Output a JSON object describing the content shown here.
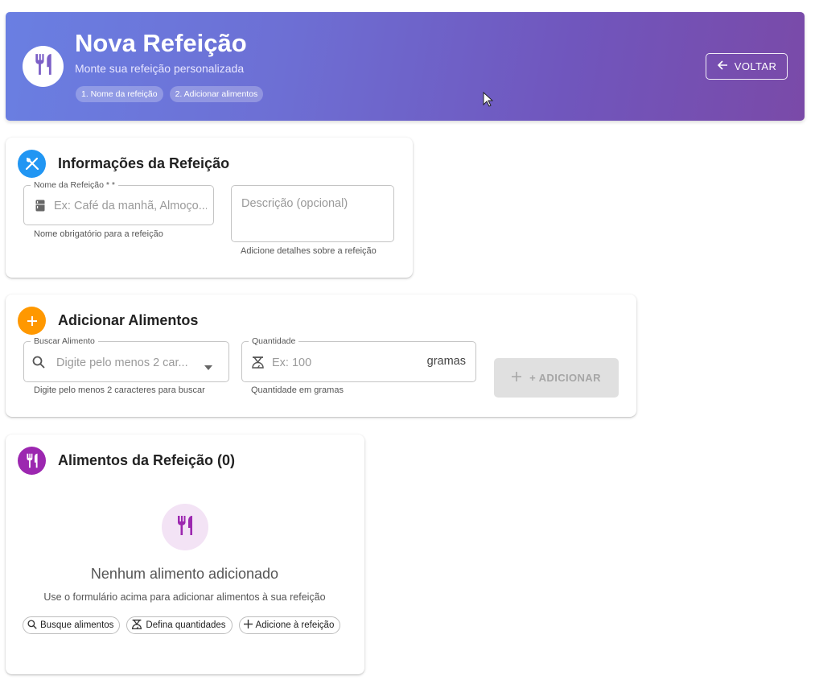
{
  "header": {
    "title": "Nova Refeição",
    "subtitle": "Monte sua refeição personalizada",
    "steps": [
      "1. Nome da refeição",
      "2. Adicionar alimentos"
    ],
    "back_label": "VOLTAR",
    "avatar_icon": "restaurant-icon"
  },
  "info_card": {
    "title": "Informações da Refeição",
    "icon": "utensils-crossed-icon",
    "icon_color": "#2196f3",
    "name_field": {
      "label": "Nome da Refeição * *",
      "placeholder": "Ex: Café da manhã, Almoço...",
      "value": "",
      "helper": "Nome obrigatório para a refeição"
    },
    "description_field": {
      "placeholder": "Descrição (opcional)",
      "value": "",
      "helper": "Adicione detalhes sobre a refeição"
    }
  },
  "add_card": {
    "title": "Adicionar Alimentos",
    "icon": "plus-icon",
    "icon_color": "#ff9800",
    "search_field": {
      "label": "Buscar Alimento",
      "placeholder": "Digite pelo menos 2 car...",
      "value": "",
      "helper": "Digite pelo menos 2 caracteres para buscar"
    },
    "quantity_field": {
      "label": "Quantidade",
      "placeholder": "Ex: 100",
      "value": "",
      "unit": "gramas",
      "helper": "Quantidade em gramas"
    },
    "add_button_label": "+ ADICIONAR"
  },
  "foods_card": {
    "title": "Alimentos da Refeição (0)",
    "icon": "restaurant-icon",
    "icon_color": "#9c27b0",
    "empty_title": "Nenhum alimento adicionado",
    "empty_text": "Use o formulário acima para adicionar alimentos à sua refeição",
    "tips": [
      {
        "icon": "search-icon",
        "label": "Busque alimentos"
      },
      {
        "icon": "scale-icon",
        "label": "Defina quantidades"
      },
      {
        "icon": "plus-icon",
        "label": "Adicione à refeição"
      }
    ]
  },
  "colors": {
    "header_gradient_start": "#6a7fe2",
    "header_gradient_end": "#7a4aa8",
    "empty_circle_bg": "#f3e3f5",
    "disabled_button_bg": "#e0e0e0"
  }
}
